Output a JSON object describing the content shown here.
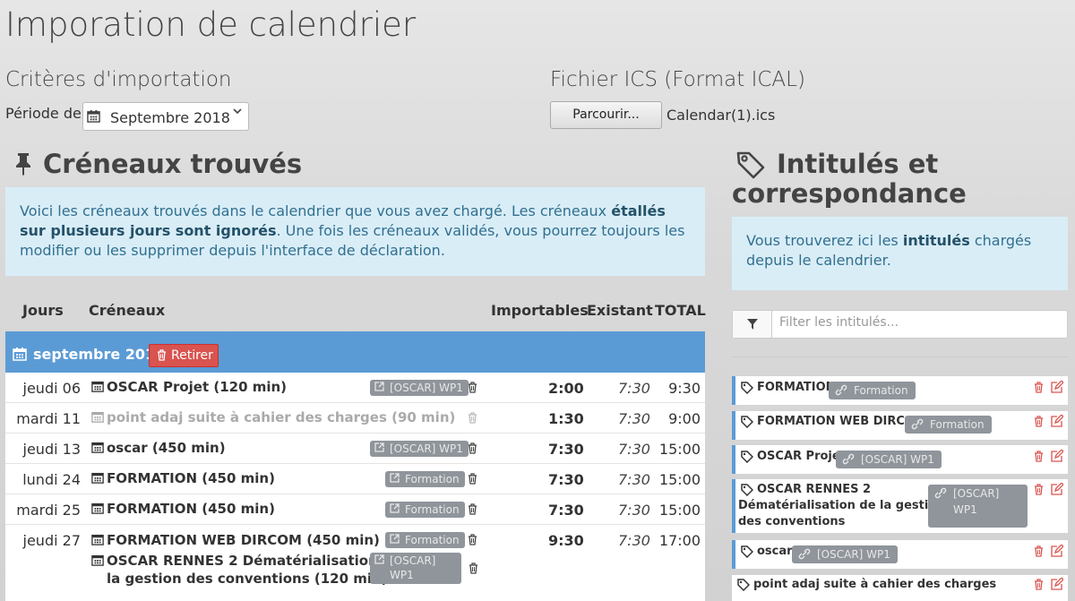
{
  "page": {
    "title": "Imporation de calendrier"
  },
  "criteria": {
    "heading": "Critères d'importation",
    "periode_label": "Période de",
    "periode_value": "Septembre 2018"
  },
  "ics": {
    "heading": "Fichier ICS (Format ICAL)",
    "browse_label": "Parcourir...",
    "file_name": "Calendar(1).ics"
  },
  "creneaux": {
    "heading": "Créneaux trouvés",
    "info_1": "Voici les créneaux trouvés dans le calendrier que vous avez chargé. Les créneaux ",
    "info_bold": "étallés sur plusieurs jours sont ignorés",
    "info_2": ". Une fois les créneaux validés, vous pourrez toujours les modifier ou les supprimer depuis l'interface de déclaration.",
    "columns": {
      "jours": "Jours",
      "creneaux": "Créneaux",
      "importables": "Importables",
      "existant": "Existant",
      "total": "TOTAL"
    },
    "month": {
      "label": "septembre 2018",
      "remove_label": "Retirer"
    },
    "rows": [
      {
        "day": "jeudi 06",
        "slots": [
          {
            "label": "OSCAR Projet (120 min)",
            "tag": "[OSCAR] WP1"
          }
        ],
        "importables": "2:00",
        "existant": "7:30",
        "total": "9:30"
      },
      {
        "day": "mardi 11",
        "slots": [
          {
            "label": "point adaj suite à cahier des charges (90 min)",
            "tag": ""
          }
        ],
        "importables": "1:30",
        "existant": "7:30",
        "total": "9:00"
      },
      {
        "day": "jeudi 13",
        "slots": [
          {
            "label": "oscar (450 min)",
            "tag": "[OSCAR] WP1"
          }
        ],
        "importables": "7:30",
        "existant": "7:30",
        "total": "15:00"
      },
      {
        "day": "lundi 24",
        "slots": [
          {
            "label": "FORMATION (450 min)",
            "tag": "Formation"
          }
        ],
        "importables": "7:30",
        "existant": "7:30",
        "total": "15:00"
      },
      {
        "day": "mardi 25",
        "slots": [
          {
            "label": "FORMATION (450 min)",
            "tag": "Formation"
          }
        ],
        "importables": "7:30",
        "existant": "7:30",
        "total": "15:00"
      },
      {
        "day": "jeudi 27",
        "slots": [
          {
            "label": "FORMATION WEB DIRCOM (450 min)",
            "tag": "Formation"
          },
          {
            "label_line1": "OSCAR RENNES 2 Dématérialisation de",
            "label_line2": "la gestion des conventions (120 min)",
            "tag": "[OSCAR] WP1"
          }
        ],
        "importables": "9:30",
        "existant": "7:30",
        "total": "17:00"
      }
    ]
  },
  "intitules": {
    "heading_line1": "Intitulés et",
    "heading_line2": "correspondance",
    "info_1": "Vous trouverez ici les ",
    "info_bold": "intitulés",
    "info_2": " chargés depuis le calendrier.",
    "filter_placeholder": "Filter les intitulés...",
    "items": [
      {
        "label": "FORMATION",
        "tag": "Formation"
      },
      {
        "label": "FORMATION WEB DIRCOM",
        "tag": "Formation"
      },
      {
        "label": "OSCAR Projet",
        "tag": "[OSCAR] WP1"
      },
      {
        "label_line1": "OSCAR RENNES 2",
        "label_line2": "Dématérialisation de la gestion",
        "label_line3": "des conventions",
        "tag": "[OSCAR] WP1"
      },
      {
        "label": "oscar",
        "tag": "[OSCAR] WP1"
      },
      {
        "label": "point adaj suite à cahier des charges",
        "tag": ""
      }
    ]
  },
  "colors": {
    "accent": "#5b9bd5",
    "danger": "#d9534f",
    "info_bg": "#d9edf7",
    "info_text": "#31708f",
    "tag_bg": "#8f959b"
  },
  "icons": [
    "calendar-icon",
    "chevron-down-icon",
    "pin-icon",
    "tags-icon",
    "trash-icon",
    "external-link-icon",
    "filter-icon",
    "tag-icon",
    "link-icon",
    "edit-icon"
  ]
}
